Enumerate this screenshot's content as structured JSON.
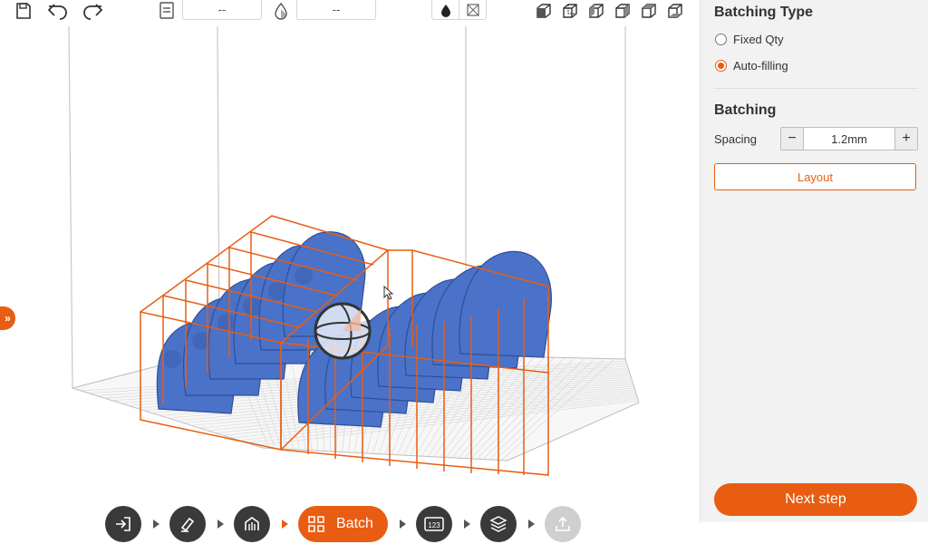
{
  "toolbar": {
    "icons": [
      "save-icon",
      "undo-icon",
      "redo-icon"
    ],
    "field_one_value": "--",
    "field_two_value": "--",
    "view_icons": [
      "view-front-icon",
      "view-back-icon",
      "view-left-icon",
      "view-right-icon",
      "view-top-icon",
      "view-bottom-icon"
    ]
  },
  "workflow": {
    "steps": [
      "import-icon",
      "orient-icon",
      "support-icon",
      "batch-icon",
      "number-icon",
      "slice-icon",
      "export-icon"
    ],
    "active_label": "Batch"
  },
  "panel": {
    "batching_type_title": "Batching Type",
    "options": [
      "Fixed Qty",
      "Auto-filling"
    ],
    "selected_option": "Auto-filling",
    "batching_title": "Batching",
    "spacing_label": "Spacing",
    "spacing_value": "1.2mm",
    "minus_label": "−",
    "plus_label": "+",
    "layout_label": "Layout",
    "next_label": "Next step"
  },
  "colors": {
    "accent": "#e85d12",
    "model": "#4a72c8",
    "panel_bg": "#f2f2f2"
  }
}
